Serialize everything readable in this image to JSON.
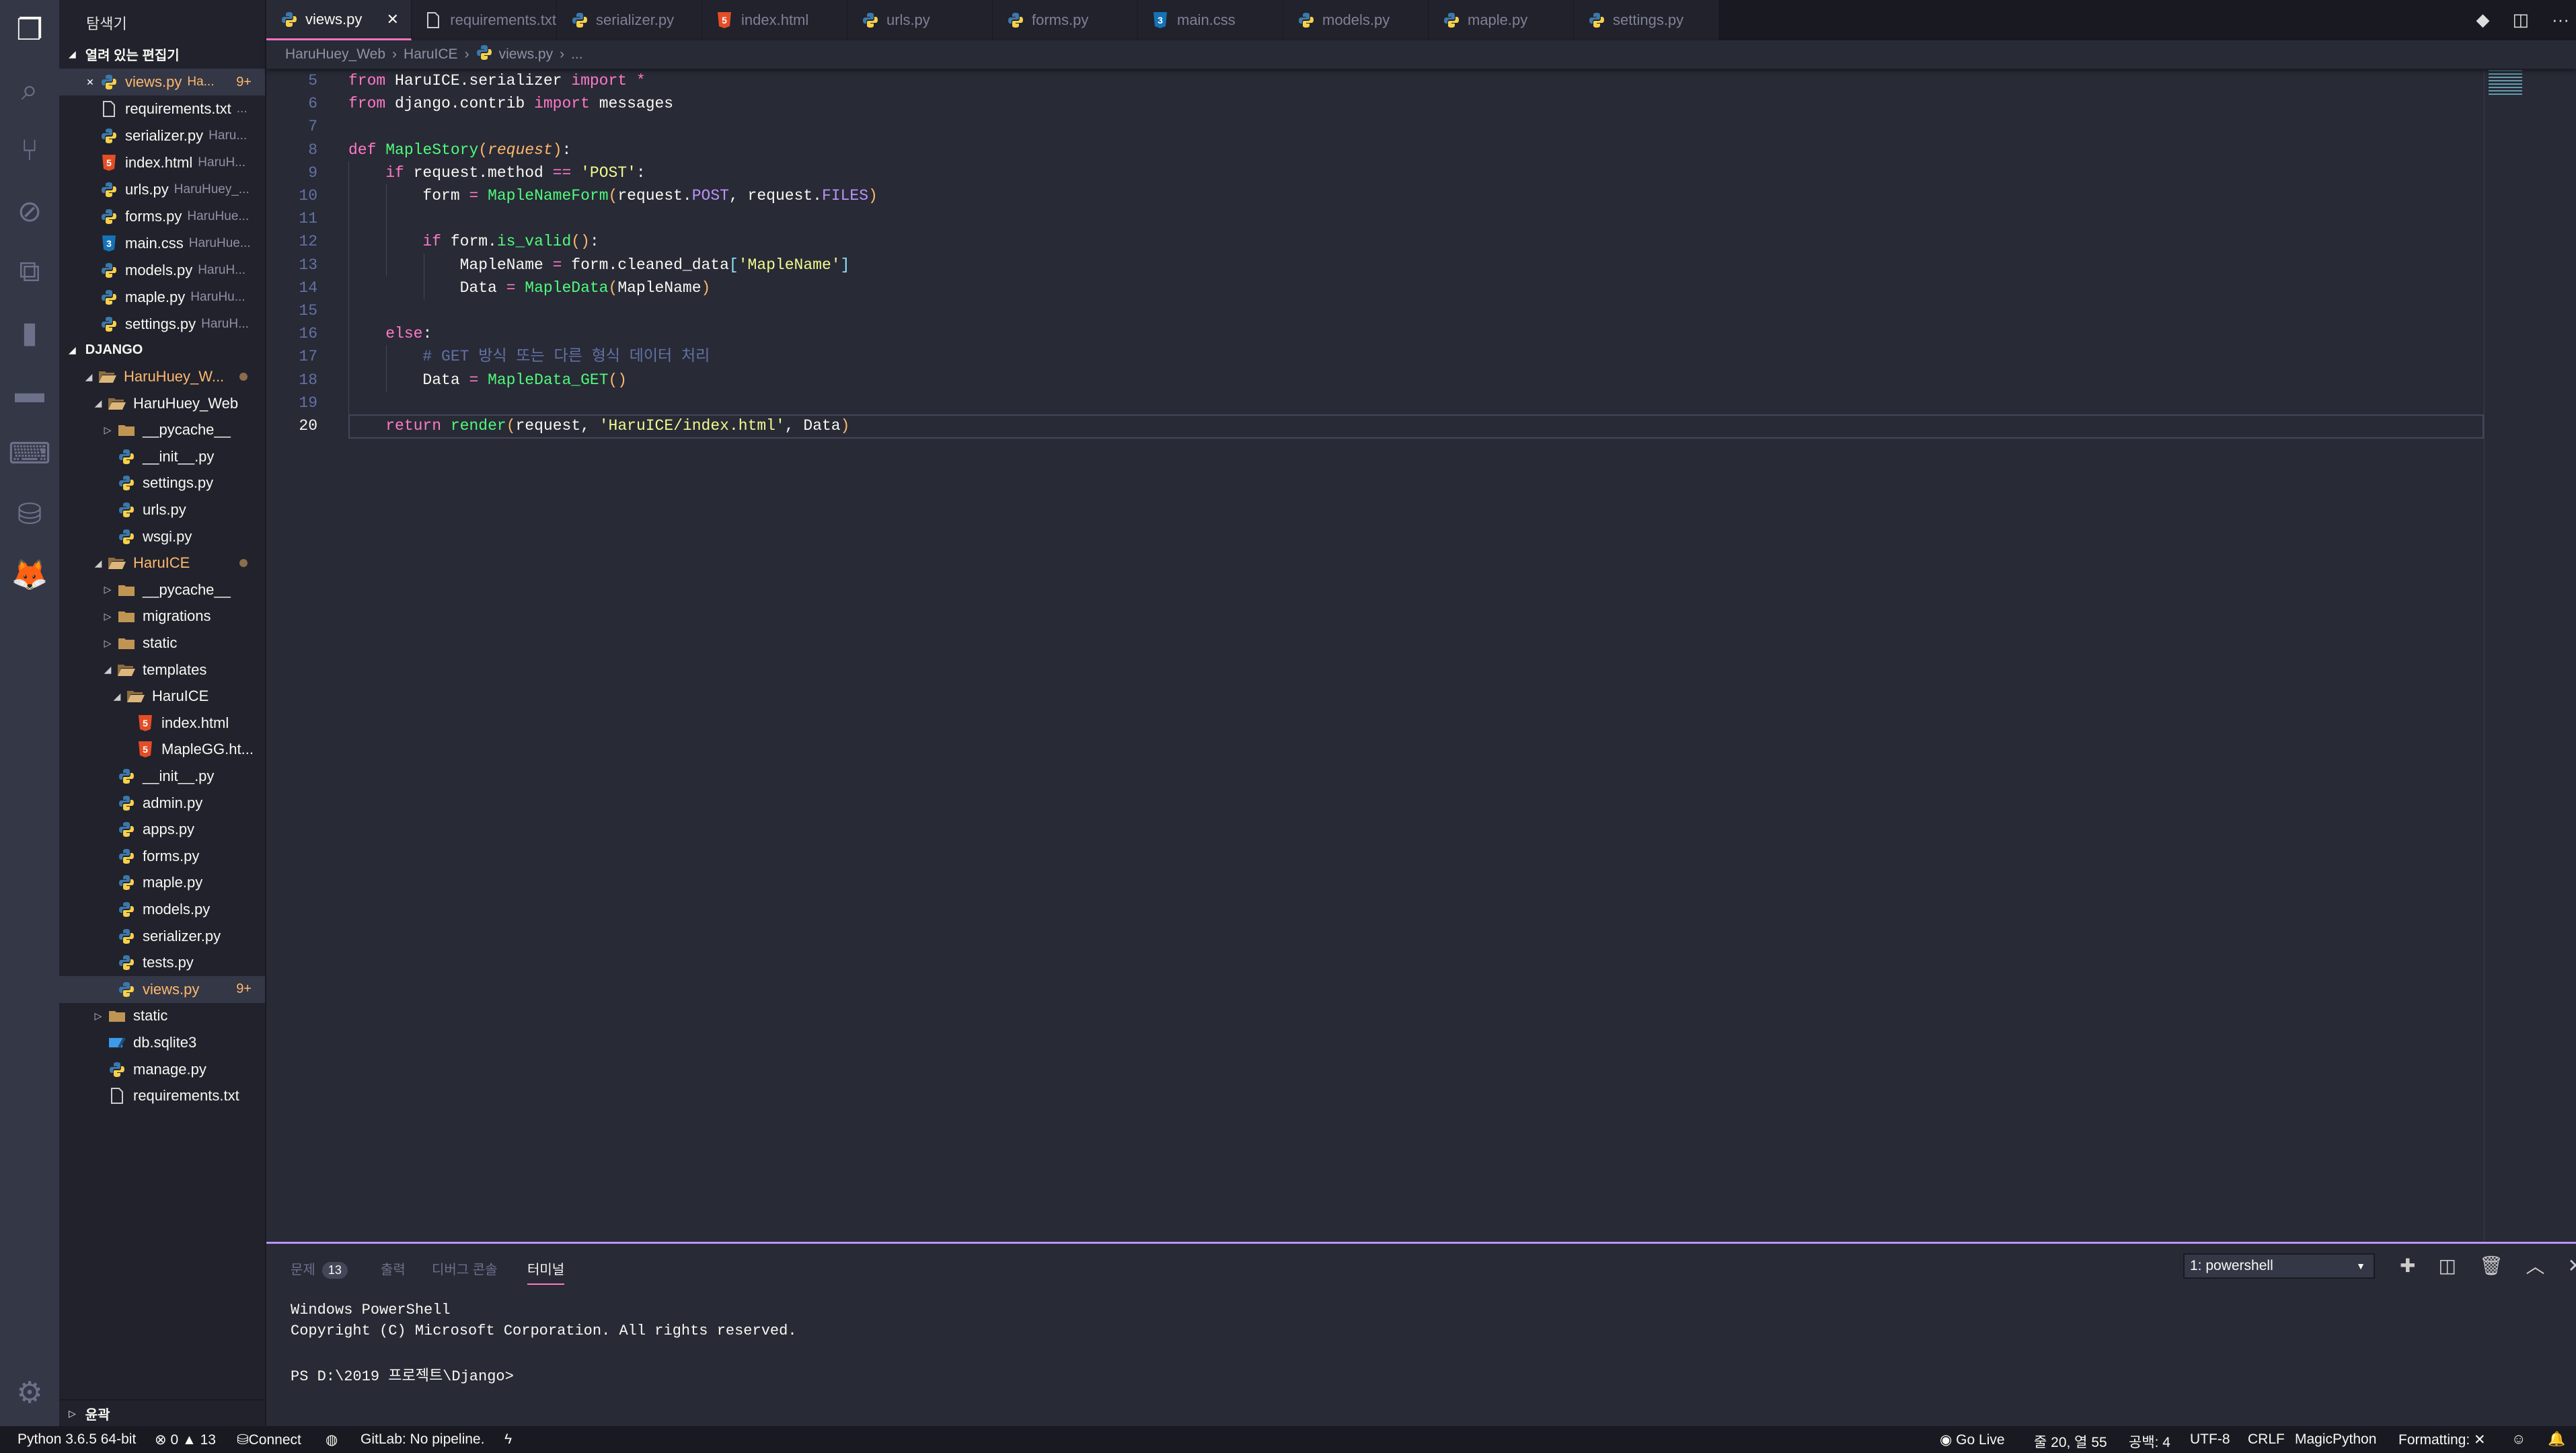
{
  "colors": {
    "editor_bg": "#282a36",
    "sidebar_bg": "#21222c",
    "activity_bg": "#343746",
    "accent": "#ff79c6",
    "panel_border": "#bd93f9",
    "modified": "#ffb86c"
  },
  "activity_bar": [
    {
      "icon": "files-icon"
    },
    {
      "icon": "search-icon"
    },
    {
      "icon": "source-control-icon"
    },
    {
      "icon": "debug-icon"
    },
    {
      "icon": "extensions-icon"
    },
    {
      "icon": "bookmark-icon"
    },
    {
      "icon": "project-folder-icon"
    },
    {
      "icon": "terminal-icon"
    },
    {
      "icon": "database-icon"
    },
    {
      "icon": "gitlab-icon"
    }
  ],
  "sidebar": {
    "title": "탐색기",
    "open_editors_header": "열려 있는 편집기",
    "open_editors": [
      {
        "name": "views.py",
        "desc": "Ha...",
        "badge": "9+",
        "icon": "python",
        "modified": true,
        "close": "✕"
      },
      {
        "name": "requirements.txt",
        "desc": "...",
        "icon": "file"
      },
      {
        "name": "serializer.py",
        "desc": "Haru...",
        "icon": "python"
      },
      {
        "name": "index.html",
        "desc": "HaruH...",
        "icon": "html"
      },
      {
        "name": "urls.py",
        "desc": "HaruHuey_...",
        "icon": "python"
      },
      {
        "name": "forms.py",
        "desc": "HaruHue...",
        "icon": "python"
      },
      {
        "name": "main.css",
        "desc": "HaruHue...",
        "icon": "css"
      },
      {
        "name": "models.py",
        "desc": "HaruH...",
        "icon": "python"
      },
      {
        "name": "maple.py",
        "desc": "HaruHu...",
        "icon": "python"
      },
      {
        "name": "settings.py",
        "desc": "HaruH...",
        "icon": "python"
      }
    ],
    "project_header": "DJANGO",
    "tree": [
      {
        "name": "HaruHuey_W...",
        "depth": 0,
        "icon": "folder-open",
        "chev": "open",
        "modified": true,
        "dot": true
      },
      {
        "name": "HaruHuey_Web",
        "depth": 1,
        "icon": "folder-open",
        "chev": "open"
      },
      {
        "name": "__pycache__",
        "depth": 2,
        "icon": "folder",
        "chev": "closed"
      },
      {
        "name": "__init__.py",
        "depth": 2,
        "icon": "python"
      },
      {
        "name": "settings.py",
        "depth": 2,
        "icon": "python"
      },
      {
        "name": "urls.py",
        "depth": 2,
        "icon": "python"
      },
      {
        "name": "wsgi.py",
        "depth": 2,
        "icon": "python"
      },
      {
        "name": "HaruICE",
        "depth": 1,
        "icon": "folder-open",
        "chev": "open",
        "modified": true,
        "dot": true
      },
      {
        "name": "__pycache__",
        "depth": 2,
        "icon": "folder",
        "chev": "closed"
      },
      {
        "name": "migrations",
        "depth": 2,
        "icon": "folder",
        "chev": "closed"
      },
      {
        "name": "static",
        "depth": 2,
        "icon": "folder",
        "chev": "closed"
      },
      {
        "name": "templates",
        "depth": 2,
        "icon": "folder-open",
        "chev": "open"
      },
      {
        "name": "HaruICE",
        "depth": 3,
        "icon": "folder-open",
        "chev": "open"
      },
      {
        "name": "index.html",
        "depth": 4,
        "icon": "html"
      },
      {
        "name": "MapleGG.ht...",
        "depth": 4,
        "icon": "html"
      },
      {
        "name": "__init__.py",
        "depth": 2,
        "icon": "python"
      },
      {
        "name": "admin.py",
        "depth": 2,
        "icon": "python"
      },
      {
        "name": "apps.py",
        "depth": 2,
        "icon": "python"
      },
      {
        "name": "forms.py",
        "depth": 2,
        "icon": "python"
      },
      {
        "name": "maple.py",
        "depth": 2,
        "icon": "python"
      },
      {
        "name": "models.py",
        "depth": 2,
        "icon": "python"
      },
      {
        "name": "serializer.py",
        "depth": 2,
        "icon": "python"
      },
      {
        "name": "tests.py",
        "depth": 2,
        "icon": "python"
      },
      {
        "name": "views.py",
        "depth": 2,
        "icon": "python",
        "modified": true,
        "badge": "9+",
        "selected": true
      },
      {
        "name": "static",
        "depth": 1,
        "icon": "folder",
        "chev": "closed"
      },
      {
        "name": "db.sqlite3",
        "depth": 1,
        "icon": "sqlite"
      },
      {
        "name": "manage.py",
        "depth": 1,
        "icon": "python"
      },
      {
        "name": "requirements.txt",
        "depth": 1,
        "icon": "file"
      }
    ],
    "outline_header": "윤곽"
  },
  "tabs": [
    {
      "name": "views.py",
      "icon": "python",
      "active": true,
      "close": "✕"
    },
    {
      "name": "requirements.txt",
      "icon": "file"
    },
    {
      "name": "serializer.py",
      "icon": "python"
    },
    {
      "name": "index.html",
      "icon": "html"
    },
    {
      "name": "urls.py",
      "icon": "python"
    },
    {
      "name": "forms.py",
      "icon": "python"
    },
    {
      "name": "main.css",
      "icon": "css"
    },
    {
      "name": "models.py",
      "icon": "python"
    },
    {
      "name": "maple.py",
      "icon": "python"
    },
    {
      "name": "settings.py",
      "icon": "python"
    }
  ],
  "breadcrumb": [
    "HaruHuey_Web",
    "HaruICE",
    "views.py",
    "..."
  ],
  "editor": {
    "current_line": 20,
    "lines": [
      {
        "n": 5,
        "t": [
          [
            "kw",
            "from"
          ],
          [
            "id",
            " HaruICE.serializer "
          ],
          [
            "kw",
            "import"
          ],
          [
            "op",
            " *"
          ]
        ]
      },
      {
        "n": 6,
        "t": [
          [
            "kw",
            "from"
          ],
          [
            "id",
            " django.contrib "
          ],
          [
            "kw",
            "import"
          ],
          [
            "id",
            " messages"
          ]
        ]
      },
      {
        "n": 7,
        "t": []
      },
      {
        "n": 8,
        "t": [
          [
            "kw",
            "def"
          ],
          [
            "id",
            " "
          ],
          [
            "fn",
            "MapleStory"
          ],
          [
            "br",
            "("
          ],
          [
            "par",
            "request"
          ],
          [
            "br",
            ")"
          ],
          [
            "id",
            ":"
          ]
        ]
      },
      {
        "n": 9,
        "t": [
          [
            "id",
            "    "
          ],
          [
            "kw",
            "if"
          ],
          [
            "id",
            " request.method "
          ],
          [
            "op",
            "=="
          ],
          [
            "id",
            " "
          ],
          [
            "str",
            "'POST'"
          ],
          [
            "id",
            ":"
          ]
        ]
      },
      {
        "n": 10,
        "t": [
          [
            "id",
            "        form "
          ],
          [
            "op",
            "="
          ],
          [
            "id",
            " "
          ],
          [
            "fn",
            "MapleNameForm"
          ],
          [
            "br",
            "("
          ],
          [
            "id",
            "request."
          ],
          [
            "cst",
            "POST"
          ],
          [
            "id",
            ", request."
          ],
          [
            "cst",
            "FILES"
          ],
          [
            "br",
            ")"
          ]
        ]
      },
      {
        "n": 11,
        "t": []
      },
      {
        "n": 12,
        "t": [
          [
            "id",
            "        "
          ],
          [
            "kw",
            "if"
          ],
          [
            "id",
            " form."
          ],
          [
            "fn",
            "is_valid"
          ],
          [
            "br",
            "()"
          ],
          [
            "id",
            ":"
          ]
        ]
      },
      {
        "n": 13,
        "t": [
          [
            "id",
            "            MapleName "
          ],
          [
            "op",
            "="
          ],
          [
            "id",
            " form.cleaned_data"
          ],
          [
            "br2",
            "["
          ],
          [
            "str",
            "'MapleName'"
          ],
          [
            "br2",
            "]"
          ]
        ]
      },
      {
        "n": 14,
        "t": [
          [
            "id",
            "            Data "
          ],
          [
            "op",
            "="
          ],
          [
            "id",
            " "
          ],
          [
            "fn",
            "MapleData"
          ],
          [
            "br",
            "("
          ],
          [
            "id",
            "MapleName"
          ],
          [
            "br",
            ")"
          ]
        ]
      },
      {
        "n": 15,
        "t": []
      },
      {
        "n": 16,
        "t": [
          [
            "id",
            "    "
          ],
          [
            "kw",
            "else"
          ],
          [
            "id",
            ":"
          ]
        ]
      },
      {
        "n": 17,
        "t": [
          [
            "cm",
            "        # GET 방식 또는 다른 형식 데이터 처리"
          ]
        ]
      },
      {
        "n": 18,
        "t": [
          [
            "id",
            "        Data "
          ],
          [
            "op",
            "="
          ],
          [
            "id",
            " "
          ],
          [
            "fn",
            "MapleData_GET"
          ],
          [
            "br",
            "()"
          ]
        ]
      },
      {
        "n": 19,
        "t": []
      },
      {
        "n": 20,
        "t": [
          [
            "id",
            "    "
          ],
          [
            "kw",
            "return"
          ],
          [
            "id",
            " "
          ],
          [
            "fn",
            "render"
          ],
          [
            "br",
            "("
          ],
          [
            "id",
            "request, "
          ],
          [
            "str",
            "'HaruICE/index.html'"
          ],
          [
            "id",
            ", Data"
          ],
          [
            "br",
            ")"
          ]
        ]
      }
    ]
  },
  "panel": {
    "tabs": [
      {
        "label": "문제",
        "badge": "13"
      },
      {
        "label": "출력"
      },
      {
        "label": "디버그 콘솔"
      },
      {
        "label": "터미널",
        "active": true
      }
    ],
    "terminal_select": "1: powershell",
    "terminal_lines": [
      "Windows PowerShell",
      "Copyright (C) Microsoft Corporation. All rights reserved.",
      "",
      "PS D:\\2019 프로젝트\\Django>"
    ]
  },
  "status": {
    "python": "Python 3.6.5 64-bit",
    "errors": "0",
    "warnings": "13",
    "connect": "Connect",
    "gitlab": "GitLab: No pipeline.",
    "go_live": "Go Live",
    "position": "줄 20, 열 55",
    "spaces": "공백: 4",
    "encoding": "UTF-8",
    "eol": "CRLF",
    "language": "MagicPython",
    "formatting": "Formatting: ✕"
  }
}
